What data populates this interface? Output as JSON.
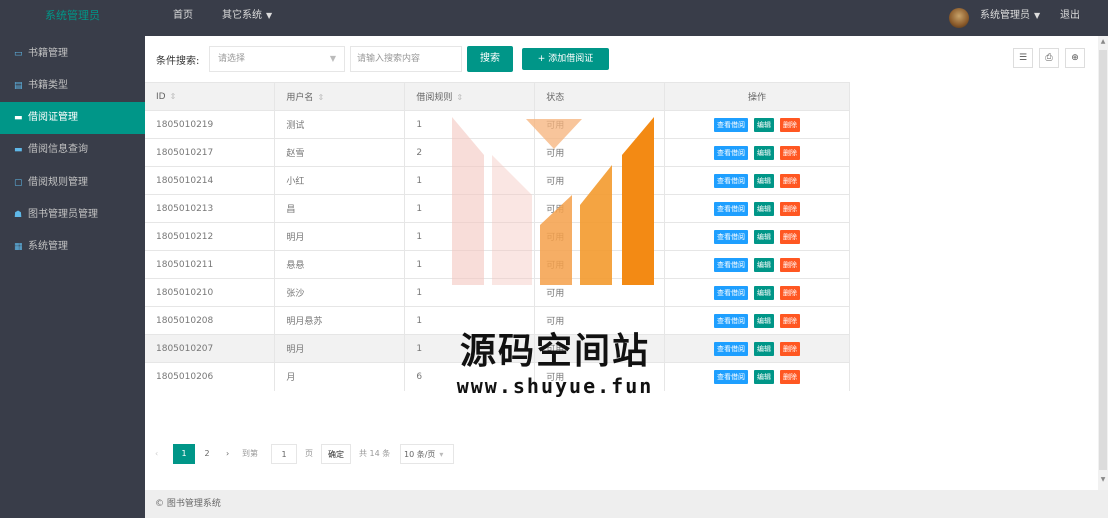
{
  "header": {
    "logo": "系统管理员",
    "nav_home": "首页",
    "nav_system": "其它系统",
    "user_name": "系统管理员",
    "logout": "退出"
  },
  "sidebar": {
    "items": [
      {
        "label": "书籍管理",
        "icon": "book-icon",
        "glyph": "▭",
        "active": false
      },
      {
        "label": "书籍类型",
        "icon": "list-icon",
        "glyph": "▤",
        "active": false
      },
      {
        "label": "借阅证管理",
        "icon": "card-icon",
        "glyph": "▬",
        "active": true
      },
      {
        "label": "借阅信息查询",
        "icon": "search-info-icon",
        "glyph": "▬",
        "active": false
      },
      {
        "label": "借阅规则管理",
        "icon": "rule-icon",
        "glyph": "▢",
        "active": false
      },
      {
        "label": "图书管理员管理",
        "icon": "users-icon",
        "glyph": "☗",
        "active": false
      },
      {
        "label": "系统管理",
        "icon": "system-icon",
        "glyph": "▦",
        "active": false
      }
    ]
  },
  "toolbar": {
    "search_label": "条件搜索:",
    "select_placeholder": "请选择",
    "input_placeholder": "请输入搜索内容",
    "search_button": "搜索",
    "add_button": "+ 添加借阅证",
    "tools": [
      {
        "icon": "columns-icon",
        "glyph": "☰"
      },
      {
        "icon": "print-icon",
        "glyph": "⎙"
      },
      {
        "icon": "export-icon",
        "glyph": "⊕"
      }
    ]
  },
  "table": {
    "columns": [
      "ID",
      "用户名",
      "借阅规则",
      "状态",
      "操作"
    ],
    "rows": [
      {
        "id": "1805010219",
        "name": "测试",
        "rule": "1",
        "status": "可用"
      },
      {
        "id": "1805010217",
        "name": "赵雪",
        "rule": "2",
        "status": "可用"
      },
      {
        "id": "1805010214",
        "name": "小红",
        "rule": "1",
        "status": "可用"
      },
      {
        "id": "1805010213",
        "name": "昌",
        "rule": "1",
        "status": "可用"
      },
      {
        "id": "1805010212",
        "name": "明月",
        "rule": "1",
        "status": "可用"
      },
      {
        "id": "1805010211",
        "name": "悬悬",
        "rule": "1",
        "status": "可用"
      },
      {
        "id": "1805010210",
        "name": "张沙",
        "rule": "1",
        "status": "可用"
      },
      {
        "id": "1805010208",
        "name": "明月悬苏",
        "rule": "1",
        "status": "可用"
      },
      {
        "id": "1805010207",
        "name": "明月",
        "rule": "1",
        "status": "可用"
      },
      {
        "id": "1805010206",
        "name": "月",
        "rule": "6",
        "status": "可用"
      }
    ],
    "ops": {
      "view": "查看借阅",
      "edit": "编辑",
      "delete": "删除"
    }
  },
  "pager": {
    "prev": "‹",
    "page1": "1",
    "page2": "2",
    "next": "›",
    "goto": "到第",
    "current": "1",
    "page_unit": "页",
    "confirm": "确定",
    "total": "共 14 条",
    "size": "10 条/页"
  },
  "footer": {
    "text": "© 图书管理系统"
  },
  "watermark": {
    "title": "源码空间站",
    "url": "www.shuyue.fun"
  },
  "colors": {
    "dark": "#393d49",
    "accent": "#009688",
    "blue": "#1e9fff",
    "red": "#ff5722"
  }
}
